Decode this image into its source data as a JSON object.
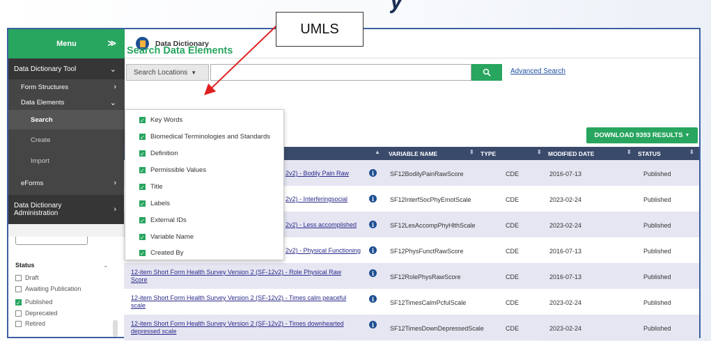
{
  "background_title": "y",
  "annotation": {
    "label": "UMLS",
    "color": "#e02020"
  },
  "sidebar": {
    "menu_label": "Menu",
    "items": [
      {
        "label": "Data Dictionary Tool",
        "icon": "chevron-down-icon"
      },
      {
        "label": "Form Structures",
        "icon": "chevron-right-icon"
      },
      {
        "label": "Data Elements",
        "icon": "chevron-down-icon"
      },
      {
        "label": "Search"
      },
      {
        "label": "Create"
      },
      {
        "label": "Import"
      },
      {
        "label": "eForms",
        "icon": "chevron-right-icon"
      },
      {
        "label": "Data Dictionary Administration",
        "icon": "chevron-right-icon"
      }
    ],
    "status_filter": {
      "label": "Status",
      "options": [
        {
          "label": "Draft",
          "checked": false
        },
        {
          "label": "Awaiting Publication",
          "checked": false
        },
        {
          "label": "Published",
          "checked": true
        },
        {
          "label": "Deprecated",
          "checked": false
        },
        {
          "label": "Retired",
          "checked": false
        }
      ]
    }
  },
  "header": {
    "title": "Data Dictionary",
    "icon": "data-dictionary-icon"
  },
  "search": {
    "heading": "Search Data Elements",
    "locations_label": "Search Locations",
    "input_value": "",
    "advanced_link": "Advanced Search",
    "download_label": "DOWNLOAD 9393 RESULTS"
  },
  "locations_dropdown": [
    {
      "label": "Key Words",
      "checked": true
    },
    {
      "label": "Biomedical Terminologies and Standards",
      "checked": true
    },
    {
      "label": "Definition",
      "checked": true
    },
    {
      "label": "Permissible Values",
      "checked": true
    },
    {
      "label": "Title",
      "checked": true
    },
    {
      "label": "Labels",
      "checked": true
    },
    {
      "label": "External IDs",
      "checked": true
    },
    {
      "label": "Variable Name",
      "checked": true
    },
    {
      "label": "Created By",
      "checked": true
    }
  ],
  "table": {
    "columns": [
      "VARIABLE NAME",
      "TYPE",
      "MODIFIED DATE",
      "STATUS"
    ],
    "rows": [
      {
        "title": "2v2) - Bodily Pain Raw",
        "title2": "",
        "variable": "SF12BodilyPainRawScore",
        "type": "CDE",
        "date": "2016-07-13",
        "status": "Published"
      },
      {
        "title": "2v2) - Interferingsocial",
        "title2": "",
        "variable": "SF12InterfSocPhyEmotScale",
        "type": "CDE",
        "date": "2023-02-24",
        "status": "Published"
      },
      {
        "title": "2v2) - Less accomplished",
        "title2": "",
        "variable": "SF12LesAccompPhyHlthScale",
        "type": "CDE",
        "date": "2023-02-24",
        "status": "Published"
      },
      {
        "title": "2v2) - Physical Functioning",
        "title2": "",
        "variable": "SF12PhysFunctRawScore",
        "type": "CDE",
        "date": "2016-07-13",
        "status": "Published"
      },
      {
        "title": "12-item Short Form Health Survey Version 2 (SF-12v2) - Role Physical Raw",
        "title2": "Score",
        "variable": "SF12RolePhysRawScore",
        "type": "CDE",
        "date": "2016-07-13",
        "status": "Published"
      },
      {
        "title": "12-item Short Form Health Survey Version 2 (SF-12v2) - Times calm peaceful",
        "title2": "scale",
        "variable": "SF12TimesCalmPcfulScale",
        "type": "CDE",
        "date": "2023-02-24",
        "status": "Published"
      },
      {
        "title": "12-item Short Form Health Survey Version 2 (SF-12v2) - Times downhearted",
        "title2": "depressed scale",
        "variable": "SF12TimesDownDepressedScale",
        "type": "CDE",
        "date": "2023-02-24",
        "status": "Published"
      }
    ]
  }
}
